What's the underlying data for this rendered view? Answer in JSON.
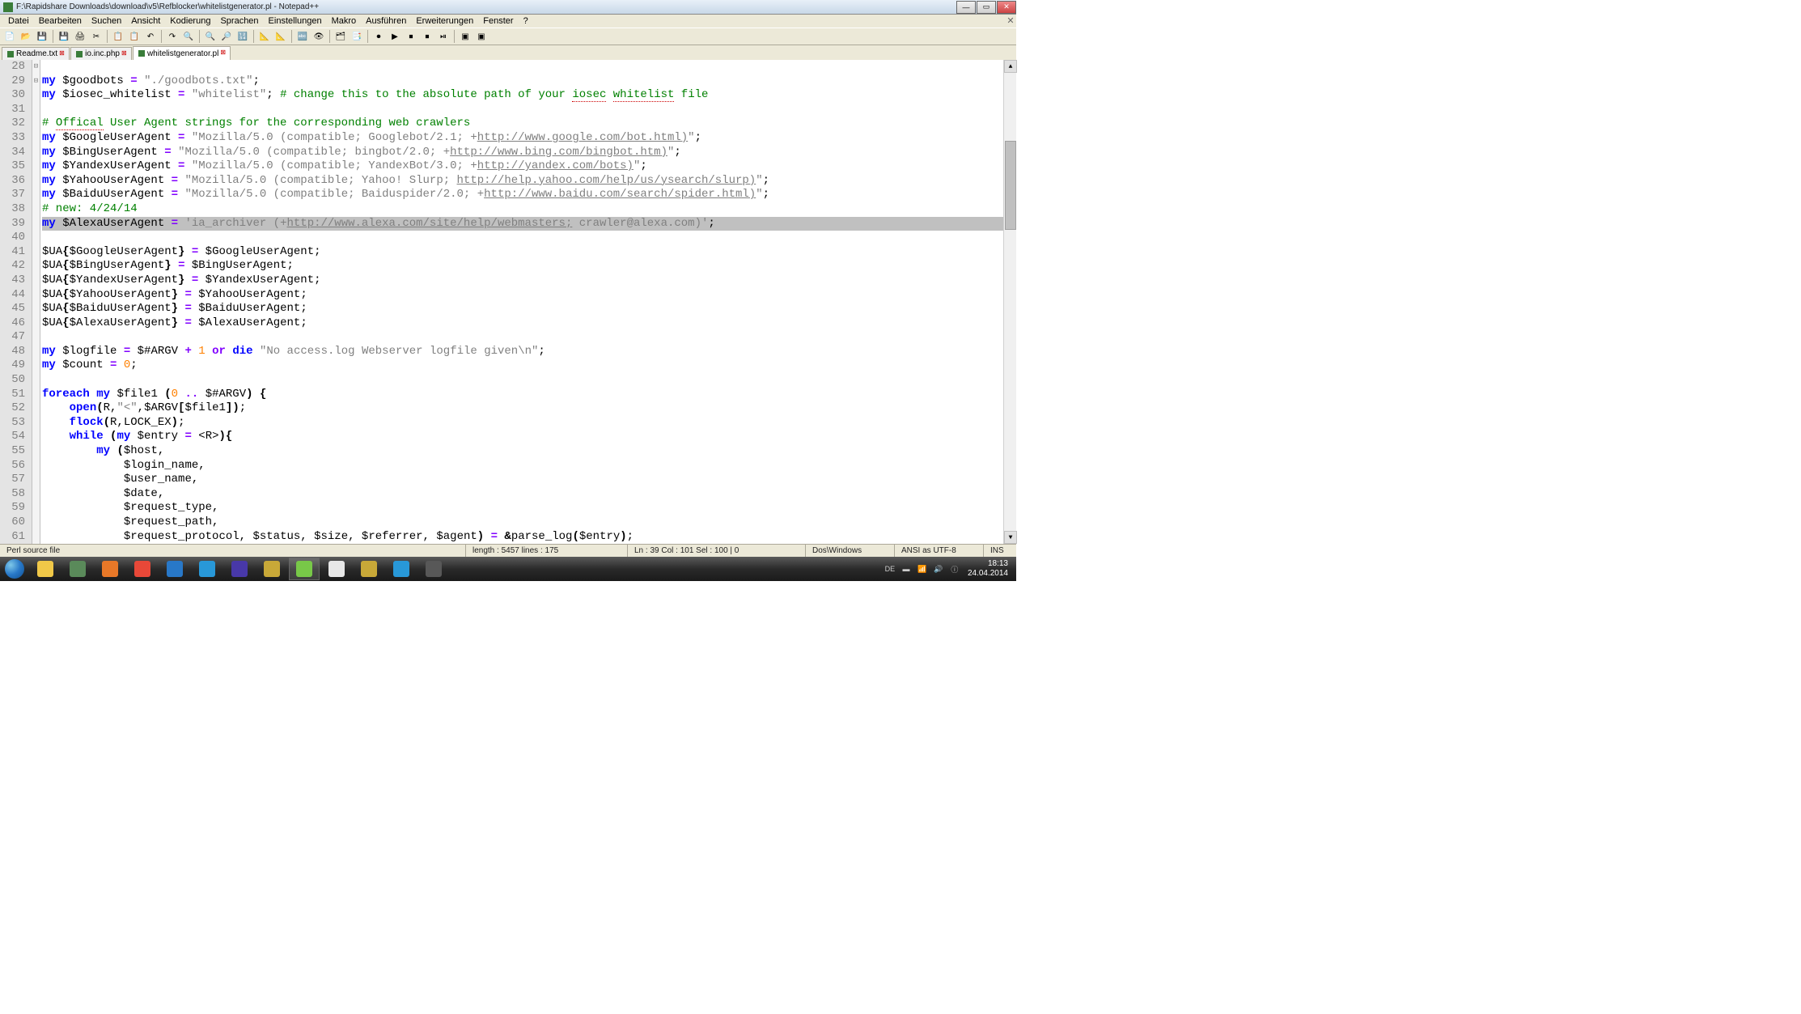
{
  "title": "F:\\Rapidshare Downloads\\download\\v5\\Refblocker\\whitelistgenerator.pl - Notepad++",
  "menus": [
    "Datei",
    "Bearbeiten",
    "Suchen",
    "Ansicht",
    "Kodierung",
    "Sprachen",
    "Einstellungen",
    "Makro",
    "Ausführen",
    "Erweiterungen",
    "Fenster",
    "?"
  ],
  "tabs": [
    {
      "label": "Readme.txt",
      "active": false
    },
    {
      "label": "io.inc.php",
      "active": false
    },
    {
      "label": "whitelistgenerator.pl",
      "active": true
    }
  ],
  "line_start": 28,
  "code_lines": [
    {
      "n": 28,
      "html": ""
    },
    {
      "n": 29,
      "html": "<span class='kw'>my</span> <span class='var'>$goodbots</span> <span class='op'>=</span> <span class='str'>\"./goodbots.txt\"</span>;"
    },
    {
      "n": 30,
      "html": "<span class='kw'>my</span> <span class='var'>$iosec_whitelist</span> <span class='op'>=</span> <span class='str'>\"whitelist\"</span>; <span class='cmt'># change this to the absolute path of your <span class='spellerr'>iosec</span> <span class='spellerr'>whitelist</span> file</span>"
    },
    {
      "n": 31,
      "html": ""
    },
    {
      "n": 32,
      "html": "<span class='cmt'># <span class='spellerr'>Offical</span> User Agent strings for the corresponding web crawlers</span>"
    },
    {
      "n": 33,
      "html": "<span class='kw'>my</span> <span class='var'>$GoogleUserAgent</span> <span class='op'>=</span> <span class='str'>\"Mozilla/5.0 (compatible; Googlebot/2.1; +<span class='url'>http://www.google.com/bot.html)</span>\"</span>;"
    },
    {
      "n": 34,
      "html": "<span class='kw'>my</span> <span class='var'>$BingUserAgent</span> <span class='op'>=</span> <span class='str'>\"Mozilla/5.0 (compatible; bingbot/2.0; +<span class='url'>http://www.bing.com/bingbot.htm)</span>\"</span>;"
    },
    {
      "n": 35,
      "html": "<span class='kw'>my</span> <span class='var'>$YandexUserAgent</span> <span class='op'>=</span> <span class='str'>\"Mozilla/5.0 (compatible; YandexBot/3.0; +<span class='url'>http://yandex.com/bots)</span>\"</span>;"
    },
    {
      "n": 36,
      "html": "<span class='kw'>my</span> <span class='var'>$YahooUserAgent</span> <span class='op'>=</span> <span class='str'>\"Mozilla/5.0 (compatible; Yahoo! Slurp; <span class='url'>http://help.yahoo.com/help/us/ysearch/slurp)</span>\"</span>;"
    },
    {
      "n": 37,
      "html": "<span class='kw'>my</span> <span class='var'>$BaiduUserAgent</span> <span class='op'>=</span> <span class='str'>\"Mozilla/5.0 (compatible; Baiduspider/2.0; +<span class='url'>http://www.baidu.com/search/spider.html)</span>\"</span>;"
    },
    {
      "n": 38,
      "html": "<span class='cmt'># new: 4/24/14</span>"
    },
    {
      "n": 39,
      "sel": true,
      "html": "<span class='kw'>my</span> <span class='var'>$AlexaUserAgent</span> <span class='op'>=</span> <span class='str'>'ia_archiver (+<span class='url'>http://www.alexa.com/site/help/webmasters;</span> crawler@alexa.com)'</span>;"
    },
    {
      "n": 40,
      "html": ""
    },
    {
      "n": 41,
      "html": "<span class='var'>$UA</span><span class='punc'>{</span><span class='var'>$GoogleUserAgent</span><span class='punc'>}</span> <span class='op'>=</span> <span class='var'>$GoogleUserAgent</span>;"
    },
    {
      "n": 42,
      "html": "<span class='var'>$UA</span><span class='punc'>{</span><span class='var'>$BingUserAgent</span><span class='punc'>}</span> <span class='op'>=</span> <span class='var'>$BingUserAgent</span>;"
    },
    {
      "n": 43,
      "html": "<span class='var'>$UA</span><span class='punc'>{</span><span class='var'>$YandexUserAgent</span><span class='punc'>}</span> <span class='op'>=</span> <span class='var'>$YandexUserAgent</span>;"
    },
    {
      "n": 44,
      "html": "<span class='var'>$UA</span><span class='punc'>{</span><span class='var'>$YahooUserAgent</span><span class='punc'>}</span> <span class='op'>=</span> <span class='var'>$YahooUserAgent</span>;"
    },
    {
      "n": 45,
      "html": "<span class='var'>$UA</span><span class='punc'>{</span><span class='var'>$BaiduUserAgent</span><span class='punc'>}</span> <span class='op'>=</span> <span class='var'>$BaiduUserAgent</span>;"
    },
    {
      "n": 46,
      "html": "<span class='var'>$UA</span><span class='punc'>{</span><span class='var'>$AlexaUserAgent</span><span class='punc'>}</span> <span class='op'>=</span> <span class='var'>$AlexaUserAgent</span>;"
    },
    {
      "n": 47,
      "html": ""
    },
    {
      "n": 48,
      "html": "<span class='kw'>my</span> <span class='var'>$logfile</span> <span class='op'>=</span> <span class='var'>$#ARGV</span> <span class='op'>+</span> <span class='num'>1</span> <span class='op'>or</span> <span class='kw'>die</span> <span class='str'>\"No access.log Webserver logfile given\\n\"</span>;"
    },
    {
      "n": 49,
      "html": "<span class='kw'>my</span> <span class='var'>$count</span> <span class='op'>=</span> <span class='num'>0</span>;"
    },
    {
      "n": 50,
      "html": ""
    },
    {
      "n": 51,
      "fold": "⊟",
      "html": "<span class='kw'>foreach</span> <span class='kw'>my</span> <span class='var'>$file1</span> <span class='punc'>(</span><span class='num'>0</span> <span class='op'>..</span> <span class='var'>$#ARGV</span><span class='punc'>)</span> <span class='punc'>{</span>"
    },
    {
      "n": 52,
      "html": "    <span class='kw'>open</span><span class='punc'>(</span>R,<span class='str'>\"&lt;\"</span>,<span class='var'>$ARGV</span><span class='punc'>[</span><span class='var'>$file1</span><span class='punc'>]</span><span class='punc'>)</span>;"
    },
    {
      "n": 53,
      "html": "    <span class='kw'>flock</span><span class='punc'>(</span>R,LOCK_EX<span class='punc'>)</span>;"
    },
    {
      "n": 54,
      "fold": "⊟",
      "html": "    <span class='kw'>while</span> <span class='punc'>(</span><span class='kw'>my</span> <span class='var'>$entry</span> <span class='op'>=</span> &lt;R&gt;<span class='punc'>)</span><span class='punc'>{</span>"
    },
    {
      "n": 55,
      "html": "        <span class='kw'>my</span> <span class='punc'>(</span><span class='var'>$host</span>,"
    },
    {
      "n": 56,
      "html": "            <span class='var'>$login_name</span>,"
    },
    {
      "n": 57,
      "html": "            <span class='var'>$user_name</span>,"
    },
    {
      "n": 58,
      "html": "            <span class='var'>$date</span>,"
    },
    {
      "n": 59,
      "html": "            <span class='var'>$request_type</span>,"
    },
    {
      "n": 60,
      "html": "            <span class='var'>$request_path</span>,"
    },
    {
      "n": 61,
      "html": "            <span class='var'>$request_protocol</span>, <span class='var'>$status</span>, <span class='var'>$size</span>, <span class='var'>$referrer</span>, <span class='var'>$agent</span><span class='punc'>)</span> <span class='op'>=</span> <span class='punc'>&amp;</span>parse_log<span class='punc'>(</span><span class='var'>$entry</span><span class='punc'>)</span>;"
    }
  ],
  "status": {
    "filetype": "Perl source file",
    "length": "length : 5457   lines : 175",
    "pos": "Ln : 39   Col : 101   Sel : 100 | 0",
    "eol": "Dos\\Windows",
    "enc": "ANSI as UTF-8",
    "ins": "INS"
  },
  "tray": {
    "lang": "DE",
    "time": "18:13",
    "date": "24.04.2014"
  },
  "toolbar_icons": [
    "📄",
    "📂",
    "💾",
    "💾",
    "🖨",
    "✂",
    "📋",
    "📋",
    "↶",
    "↷",
    "🔍",
    "🔍",
    "🔎",
    "🔢",
    "📐",
    "📐",
    "🔤",
    "👁",
    "🗂",
    "📑",
    "⏺",
    "▶",
    "⏹",
    "⏹",
    "⏯",
    "▣",
    "▣"
  ],
  "task_icons": [
    {
      "name": "explorer",
      "color": "#f0c848"
    },
    {
      "name": "dreamweaver",
      "color": "#5a8a5a"
    },
    {
      "name": "firefox",
      "color": "#e87828"
    },
    {
      "name": "chrome",
      "color": "#e84838"
    },
    {
      "name": "ie",
      "color": "#2878c8"
    },
    {
      "name": "quicktime",
      "color": "#2898d8"
    },
    {
      "name": "eclipse",
      "color": "#4838a8"
    },
    {
      "name": "shield",
      "color": "#c8a838"
    },
    {
      "name": "notepadpp",
      "color": "#78c848",
      "active": true
    },
    {
      "name": "skull",
      "color": "#e8e8e8"
    },
    {
      "name": "hex",
      "color": "#c8a838"
    },
    {
      "name": "cube",
      "color": "#2898d8"
    },
    {
      "name": "steam",
      "color": "#585858"
    }
  ]
}
